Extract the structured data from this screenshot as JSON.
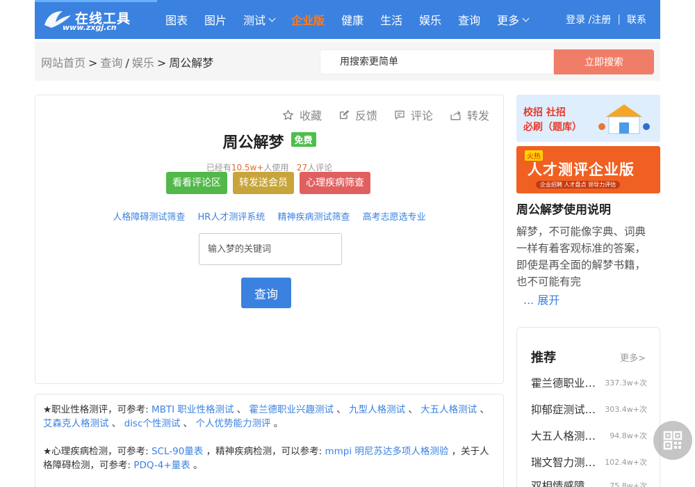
{
  "colors": {
    "nav_bg": "#3b82e0",
    "accent_orange": "#ff7a1a",
    "search_btn": "#f07d68",
    "link": "#3b82e0"
  },
  "nav": {
    "logo_text": "在线工具",
    "logo_url": "www.zxgj.cn",
    "items": [
      {
        "label": "图表"
      },
      {
        "label": "图片"
      },
      {
        "label": "测试"
      },
      {
        "label": "企业版"
      },
      {
        "label": "健康"
      },
      {
        "label": "生活"
      },
      {
        "label": "娱乐"
      },
      {
        "label": "查询"
      },
      {
        "label": "更多"
      }
    ],
    "login": "登录 /注册",
    "contact": "联系"
  },
  "breadcrumb": {
    "home": "网站首页",
    "sep1": ">",
    "query": "查询",
    "sep2": "/",
    "ent": "娱乐",
    "sep3": ">",
    "current": "周公解梦"
  },
  "search": {
    "placeholder": "用搜索更简单",
    "button": "立即搜索"
  },
  "tool": {
    "actions": {
      "fav": "收藏",
      "feedback": "反馈",
      "comment": "评论",
      "share": "转发"
    },
    "title": "周公解梦",
    "free_badge": "免费",
    "stats": {
      "prefix": "已经有",
      "users": "10.5w+",
      "users_suffix": "人使用",
      "comments": "27",
      "comments_suffix": "人评论"
    },
    "buttons": {
      "view_comments": "看看评论区",
      "share_vip": "转发送会员",
      "screening": "心理疾病筛查"
    },
    "links": [
      "人格障碍测试筛查",
      "HR人才测评系统",
      "精神疾病测试筛查",
      "高考志愿选专业"
    ],
    "keyword_placeholder": "输入梦的关键词",
    "query_button": "查询"
  },
  "refs": {
    "p1_prefix": "★职业性格测评，可参考:",
    "p1_links": [
      "MBTI 职业性格测试",
      "霍兰德职业兴趣测试",
      "九型人格测试",
      "大五人格测试",
      "艾森克人格测试",
      "disc个性测试",
      "个人优势能力测评"
    ],
    "p2_prefix": "★心理疾病检测，可参考:",
    "p2_link1": "SCL-90量表",
    "p2_mid": "，精神疾病检测，可以参考:",
    "p2_link2": "mmpi 明尼苏达多项人格测验",
    "p2_mid2": "，关于人格障碍检测，可参考:",
    "p2_link3": "PDQ-4+量表",
    "sep": "、",
    "end": "。"
  },
  "ads": {
    "ad1_line1": "校招 社招",
    "ad1_line2": "必刷（题库）",
    "ad2_hot": "火热",
    "ad2_main": "人才测评企业版",
    "ad2_sub": "企业招聘 人才盘点 领导力评估"
  },
  "usage": {
    "title": "周公解梦使用说明",
    "text": "解梦，不可能像字典、词典一样有着客观标准的答案，即使是再全面的解梦书籍，也不可能有完",
    "expand": "... 展开"
  },
  "recommend": {
    "title": "推荐",
    "more": "更多>",
    "items": [
      {
        "name": "霍兰德职业兴趣测试",
        "count": "337.3w+次"
      },
      {
        "name": "抑郁症测试量表",
        "count": "303.4w+次"
      },
      {
        "name": "大五人格测试免费版",
        "count": "94.8w+次"
      },
      {
        "name": "瑞文智力测试题",
        "count": "102.4w+次"
      },
      {
        "name": "双相情感障碍测试",
        "count": "75.8w+次"
      }
    ]
  }
}
